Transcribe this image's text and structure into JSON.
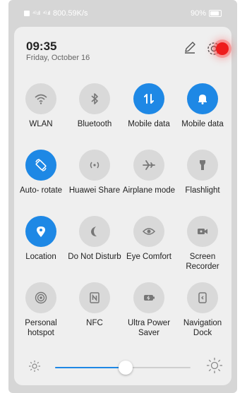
{
  "statusbar": {
    "net_speed": "800.59K/s",
    "battery": "90%",
    "signal_label_1": "⁴ᴳ.ıll",
    "signal_label_2": "⁴ᴳ.ıll"
  },
  "header": {
    "time": "09:35",
    "date": "Friday, October 16"
  },
  "tiles": [
    {
      "label": "WLAN",
      "icon": "wifi-icon",
      "on": false
    },
    {
      "label": "Bluetooth",
      "icon": "bluetooth-icon",
      "on": false
    },
    {
      "label": "Mobile data",
      "icon": "mobile-data-icon",
      "on": true
    },
    {
      "label": "Mobile data",
      "icon": "bell-icon",
      "on": true
    },
    {
      "label": "Auto- rotate",
      "icon": "auto-rotate-icon",
      "on": true
    },
    {
      "label": "Huawei Share",
      "icon": "huawei-share-icon",
      "on": false
    },
    {
      "label": "Airplane mode",
      "icon": "airplane-icon",
      "on": false
    },
    {
      "label": "Flashlight",
      "icon": "flashlight-icon",
      "on": false
    },
    {
      "label": "Location",
      "icon": "location-icon",
      "on": true
    },
    {
      "label": "Do Not Disturb",
      "icon": "moon-icon",
      "on": false
    },
    {
      "label": "Eye Comfort",
      "icon": "eye-icon",
      "on": false
    },
    {
      "label": "Screen Recorder",
      "icon": "screen-recorder-icon",
      "on": false
    },
    {
      "label": "Personal hotspot",
      "icon": "hotspot-icon",
      "on": false
    },
    {
      "label": "NFC",
      "icon": "nfc-icon",
      "on": false
    },
    {
      "label": "Ultra Power Saver",
      "icon": "battery-saver-icon",
      "on": false
    },
    {
      "label": "Navigation Dock",
      "icon": "navigation-dock-icon",
      "on": false
    }
  ],
  "brightness": {
    "level": 0.52
  },
  "colors": {
    "accent": "#1e88e5",
    "record": "#ee1d1d"
  }
}
